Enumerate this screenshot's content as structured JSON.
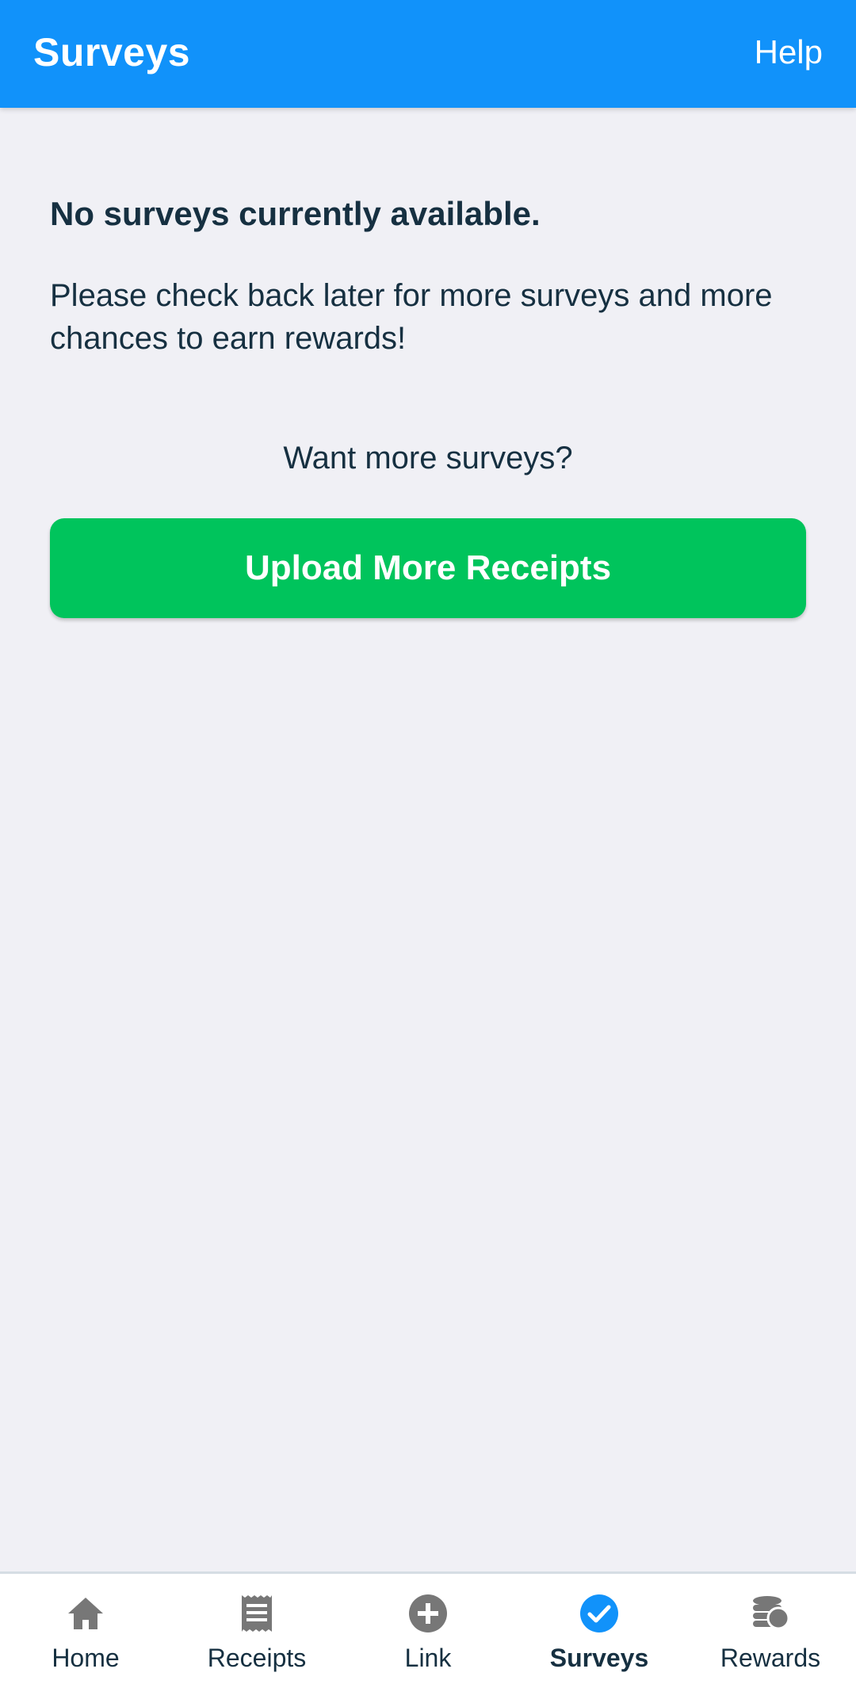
{
  "appbar": {
    "title": "Surveys",
    "help_label": "Help",
    "color": "#1192fa"
  },
  "main": {
    "heading": "No surveys currently available.",
    "message": "Please check back later for more surveys and more chances to earn rewards!",
    "want_more": "Want more surveys?",
    "upload_button_label": "Upload More Receipts",
    "upload_button_color": "#00c45c"
  },
  "bottom_nav": {
    "items": [
      {
        "label": "Home",
        "icon": "home-icon"
      },
      {
        "label": "Receipts",
        "icon": "receipt-icon"
      },
      {
        "label": "Link",
        "icon": "plus-circle-icon"
      },
      {
        "label": "Surveys",
        "icon": "check-circle-icon",
        "active": true
      },
      {
        "label": "Rewards",
        "icon": "coins-icon"
      }
    ],
    "active_color": "#1192fa",
    "inactive_icon_color": "#777777"
  }
}
